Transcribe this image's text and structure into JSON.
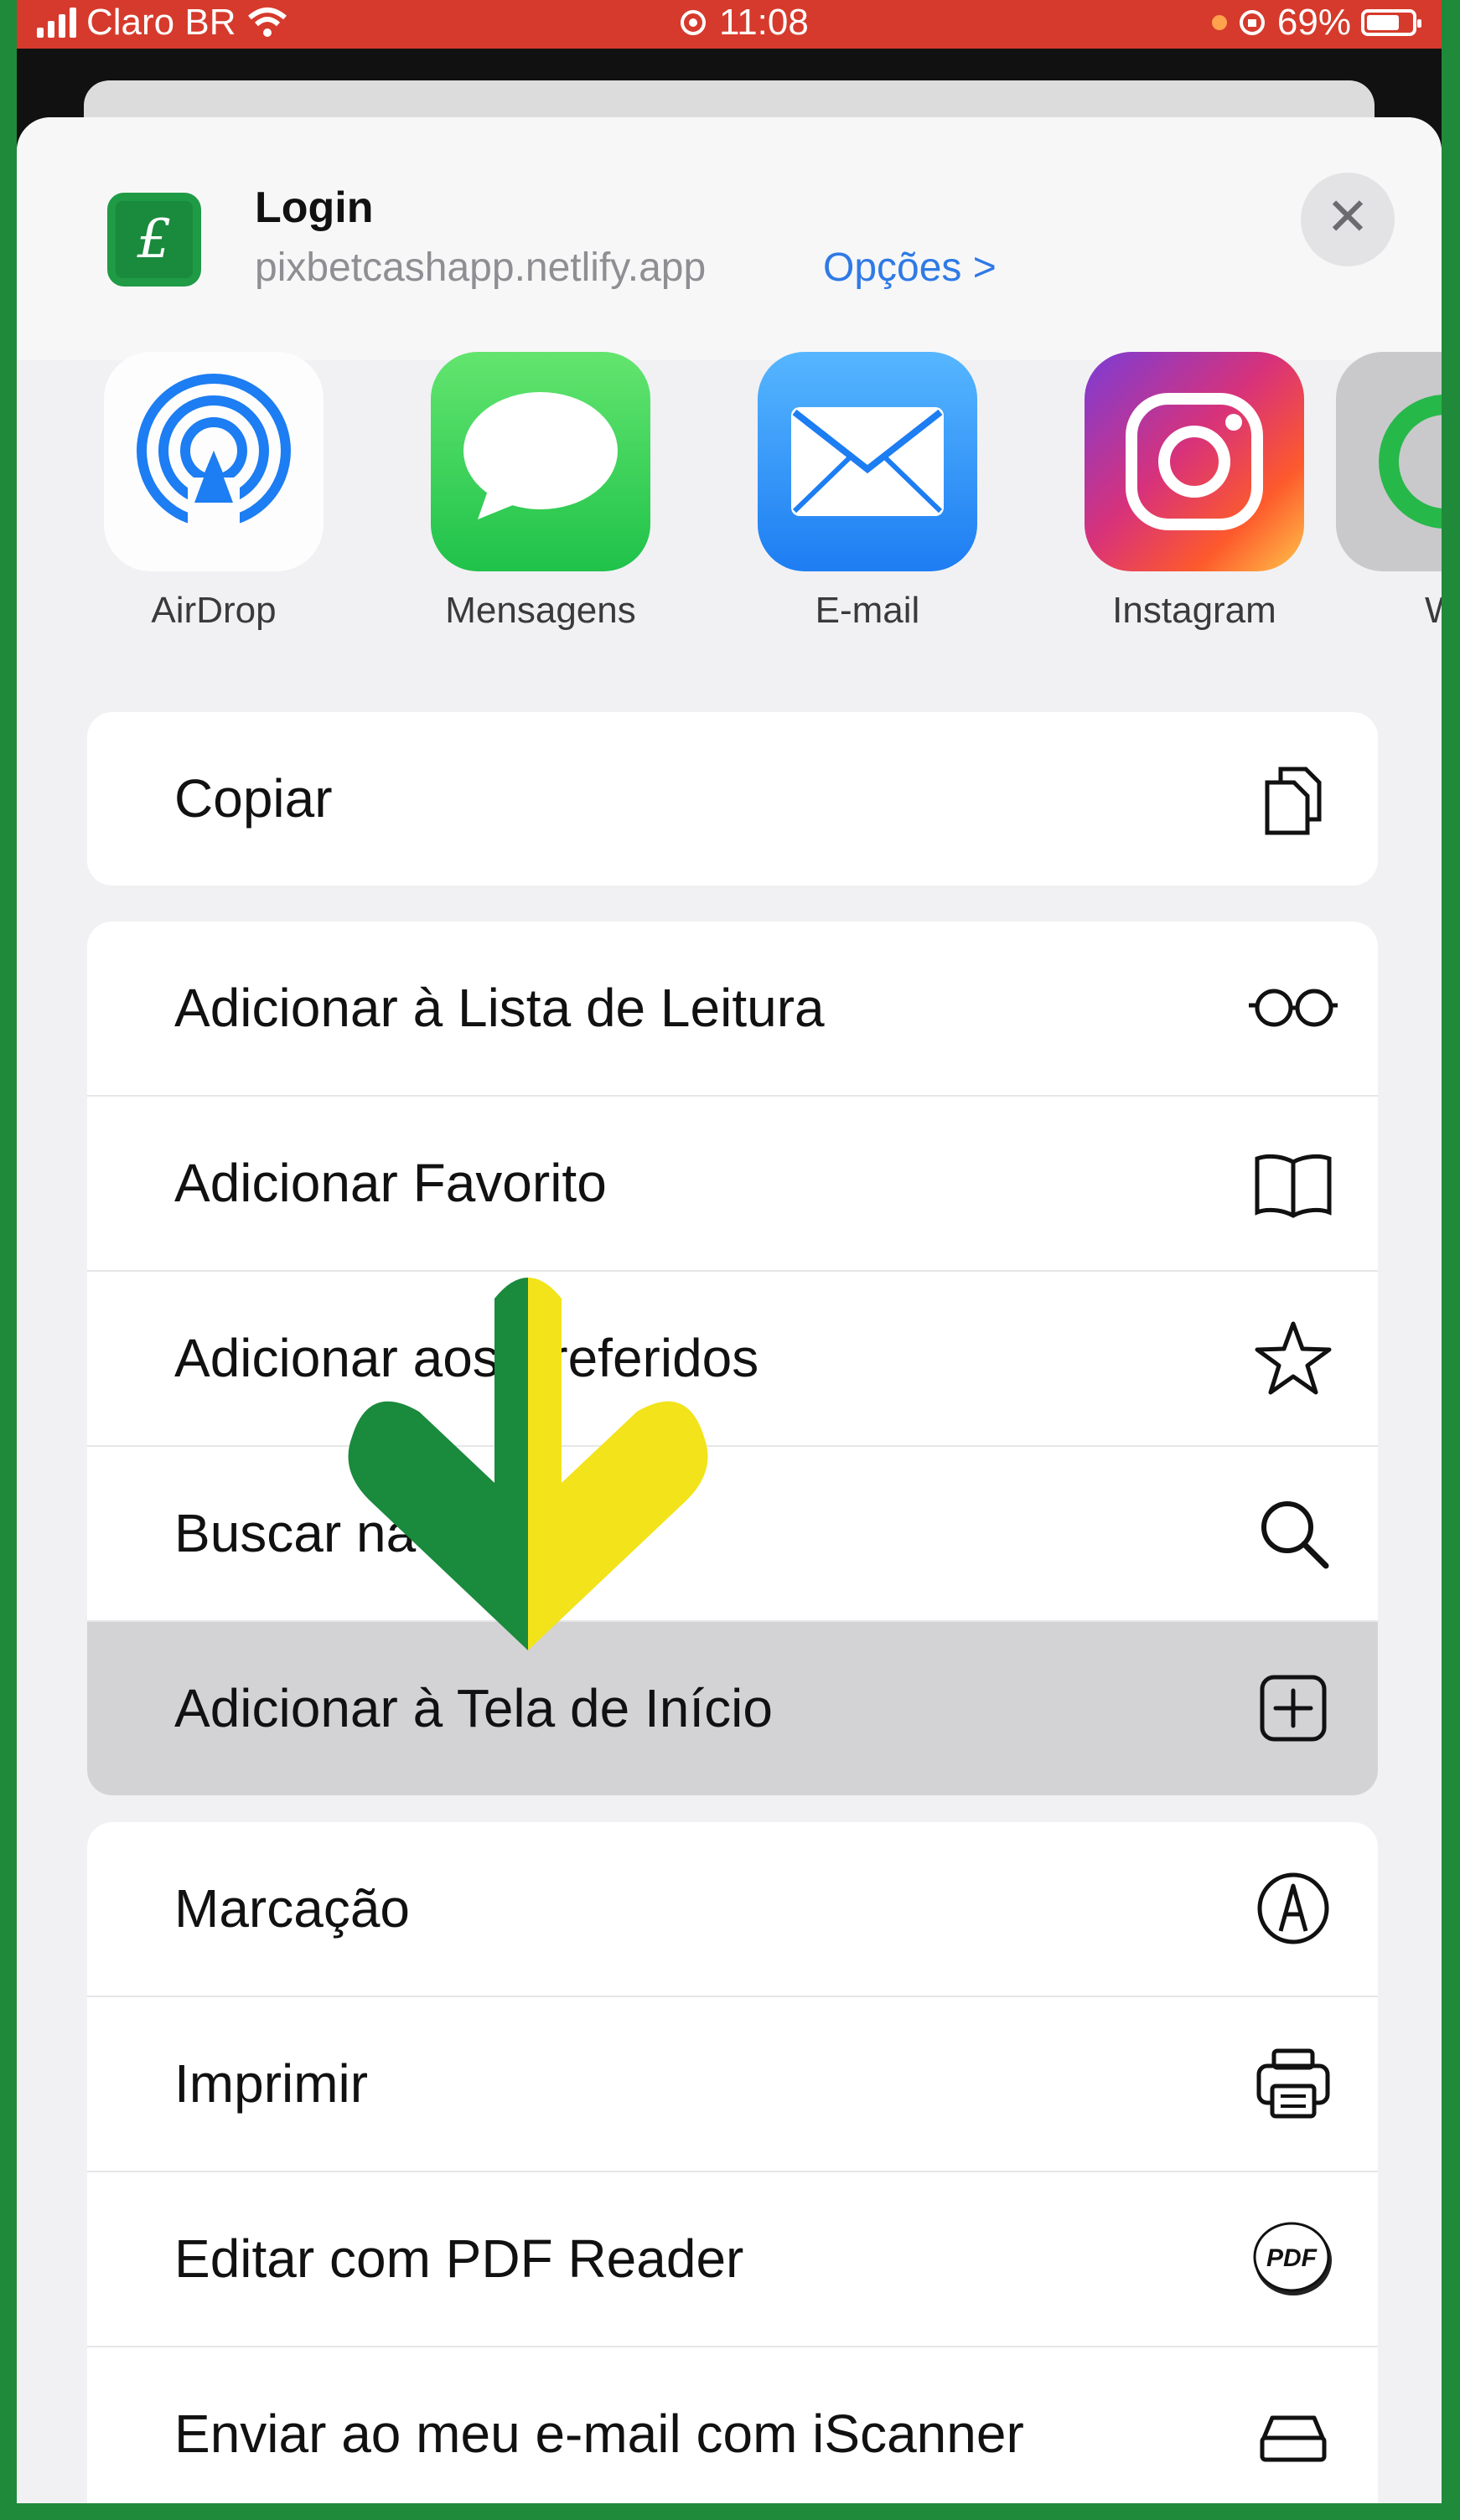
{
  "status_bar": {
    "carrier": "Claro BR",
    "time": "11:08",
    "battery": "69%"
  },
  "header": {
    "title": "Login",
    "url": "pixbetcashapp.netlify.app",
    "options_label": "Opções >",
    "close_symbol": "✕"
  },
  "share_apps": [
    {
      "label": "AirDrop",
      "icon": "airdrop-icon"
    },
    {
      "label": "Mensagens",
      "icon": "messages-icon"
    },
    {
      "label": "E-mail",
      "icon": "mail-icon"
    },
    {
      "label": "Instagram",
      "icon": "instagram-icon"
    },
    {
      "label": "Wh",
      "icon": "whatsapp-icon"
    }
  ],
  "actions": {
    "group1": [
      {
        "label": "Copiar",
        "icon": "copy-icon"
      }
    ],
    "group2": [
      {
        "label": "Adicionar à Lista de Leitura",
        "icon": "glasses-icon"
      },
      {
        "label": "Adicionar Favorito",
        "icon": "book-icon"
      },
      {
        "label": "Adicionar aos Preferidos",
        "icon": "star-icon"
      },
      {
        "label": "Buscar na Página",
        "icon": "search-icon"
      },
      {
        "label": "Adicionar à Tela de Início",
        "icon": "plus-square-icon",
        "highlighted": true
      }
    ],
    "group3": [
      {
        "label": "Marcação",
        "icon": "markup-icon"
      },
      {
        "label": "Imprimir",
        "icon": "printer-icon"
      },
      {
        "label": "Editar com PDF Reader",
        "icon": "pdf-icon",
        "badge": "PDF"
      },
      {
        "label": "Enviar ao meu e-mail com iScanner",
        "icon": "scanner-icon"
      }
    ]
  },
  "colors": {
    "accent_blue": "#2f7ae5",
    "status_red": "#d63a2c",
    "brand_green": "#1f8a3a",
    "arrow_green": "#1a8a3c",
    "arrow_yellow": "#f2e31a"
  }
}
